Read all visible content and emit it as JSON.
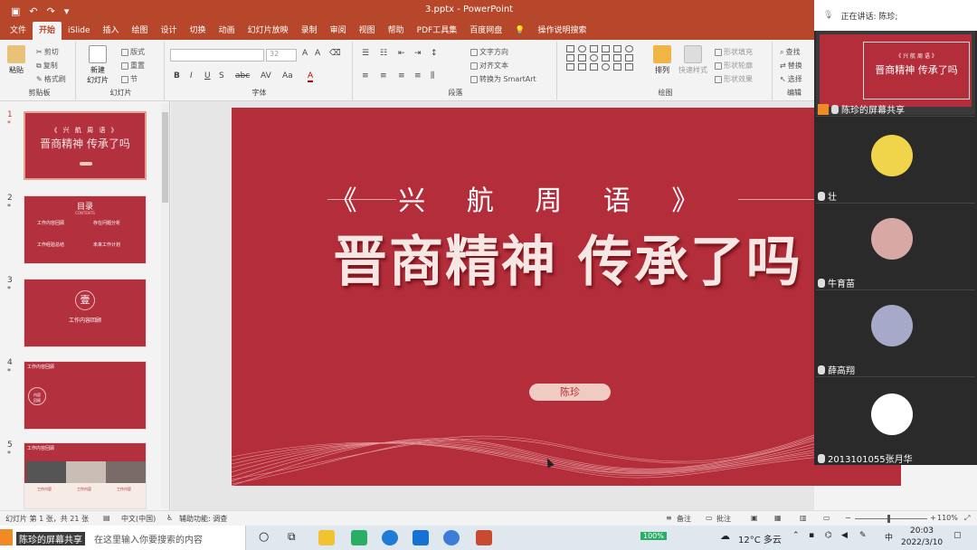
{
  "window": {
    "title": "3.pptx  -  PowerPoint"
  },
  "ribbon_tabs": [
    "文件",
    "开始",
    "iSlide",
    "插入",
    "绘图",
    "设计",
    "切换",
    "动画",
    "幻灯片放映",
    "录制",
    "审阅",
    "视图",
    "帮助",
    "PDF工具集",
    "百度网盘"
  ],
  "tell_me": "操作说明搜索",
  "ribbon": {
    "clipboard": {
      "paste": "粘贴",
      "cut": "剪切",
      "copy": "复制",
      "format_painter": "格式刷",
      "label": "剪贴板"
    },
    "slides": {
      "new_slide": "新建\n幻灯片",
      "layout": "版式",
      "reset": "重置",
      "section": "节",
      "label": "幻灯片"
    },
    "font": {
      "size": "32",
      "label": "字体",
      "bold": "B",
      "italic": "I",
      "underline": "U",
      "shadow": "S",
      "strike": "abc",
      "spacing": "AV",
      "case": "Aa",
      "color": "A"
    },
    "paragraph": {
      "text_direction": "文字方向",
      "align_text": "对齐文本",
      "smartart": "转换为 SmartArt",
      "label": "段落"
    },
    "drawing": {
      "arrange": "排列",
      "quick_styles": "快速样式",
      "fill": "形状填充",
      "outline": "形状轮廓",
      "effects": "形状效果",
      "label": "绘图"
    },
    "editing": {
      "find": "查找",
      "replace": "替换",
      "select": "选择",
      "label": "编辑"
    }
  },
  "thumbnails": [
    {
      "num": "1",
      "title": "《 兴 航 周 语 》",
      "main": "晋商精神 传承了吗"
    },
    {
      "num": "2",
      "title": "目录",
      "sub": "CONTENTS",
      "items": [
        "工作内容回顾",
        "存在问题分析",
        "工作经验总结",
        "未来工作计划"
      ]
    },
    {
      "num": "3",
      "badge": "壹",
      "title": "工作内容回顾"
    },
    {
      "num": "4",
      "title": "工作内容回顾",
      "side": "内容\n回顾"
    },
    {
      "num": "5",
      "title": "工作内容回顾",
      "captions": [
        "工作内容",
        "工作内容",
        "工作内容"
      ]
    }
  ],
  "slide": {
    "subtitle": "《 兴 航 周 语 》",
    "title": "晋商精神 传承了吗",
    "author": "陈珍"
  },
  "meeting": {
    "speaking_label": "正在讲话: 陈珍;",
    "share_label": "陈珍的屏幕共享",
    "participants": [
      {
        "name": "壮",
        "avatar_color": "#f0d54a"
      },
      {
        "name": "牛育苗",
        "avatar_color": "#d7a8a4"
      },
      {
        "name": "薛高翔",
        "avatar_color": "#a7a9c8"
      },
      {
        "name": "2013101055张月华",
        "avatar_color": "#ffffff"
      }
    ]
  },
  "statusbar": {
    "slide_info": "幻灯片 第 1 张，共 21 张",
    "language": "中文(中国)",
    "accessibility": "辅助功能: 调查",
    "notes": "备注",
    "comments": "批注",
    "zoom": "110%"
  },
  "taskbar": {
    "search_placeholder": "在这里输入你要搜索的内容",
    "share_tag": "陈珍的屏幕共享",
    "battery": "100%",
    "weather": "12°C 多云",
    "time": "20:03",
    "date": "2022/3/10"
  }
}
